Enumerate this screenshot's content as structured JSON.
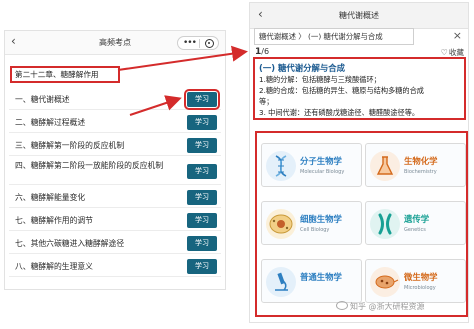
{
  "left": {
    "back_glyph": "‹",
    "title": "高频考点",
    "chapter": "第二十二章、糖酵解作用",
    "sections": [
      {
        "label": "一、糖代谢概述",
        "button": "学习"
      },
      {
        "label": "二、糖酵解过程概述",
        "button": "学习"
      },
      {
        "label": "三、糖酵解第一阶段的反应机制",
        "button": "学习"
      },
      {
        "label": "四、糖酵解第二阶段一放能阶段的反应机制",
        "button": "学习"
      },
      {
        "label": "六、糖酵解能量变化",
        "button": "学习"
      },
      {
        "label": "七、糖酵解作用的调节",
        "button": "学习"
      },
      {
        "label": "七、其他六碳糖进入糖酵解途径",
        "button": "学习"
      },
      {
        "label": "八、糖酵解的生理意义",
        "button": "学习"
      }
    ]
  },
  "right": {
    "back_glyph": "‹",
    "title": "糖代谢概述",
    "breadcrumb": "糖代谢概述  〉 (一) 糖代谢分解与合成",
    "close_glyph": "×",
    "page_current": "1",
    "page_total": "/6",
    "fav_label": "收藏",
    "content": {
      "heading": "(一) 糖代谢分解与合成",
      "lines": [
        "1.糖的分解：包括糖酵与三羧酸循环；",
        "2.糖的合成：包括糖的异生、糖原与结构多糖的合成",
        "等；",
        "3. 中间代谢：还有磷酸戊糖途径、糖醛酸途径等。"
      ]
    },
    "subjects": [
      {
        "zh": "分子生物学",
        "en": "Molecular Biology",
        "color": "#2d7fc1",
        "icon": "dna-icon"
      },
      {
        "zh": "生物化学",
        "en": "Biochemistry",
        "color": "#d46a1c",
        "icon": "flask-icon"
      },
      {
        "zh": "细胞生物学",
        "en": "Cell Biology",
        "color": "#2d7fc1",
        "icon": "cell-icon"
      },
      {
        "zh": "遗传学",
        "en": "Genetics",
        "color": "#18a094",
        "icon": "chromosome-icon"
      },
      {
        "zh": "普通生物学",
        "en": "",
        "color": "#2d7fc1",
        "icon": "microscope-icon"
      },
      {
        "zh": "微生物学",
        "en": "Microbiology",
        "color": "#d46a1c",
        "icon": "microbe-icon"
      }
    ]
  },
  "watermark": "知乎 @浙大研程资源"
}
